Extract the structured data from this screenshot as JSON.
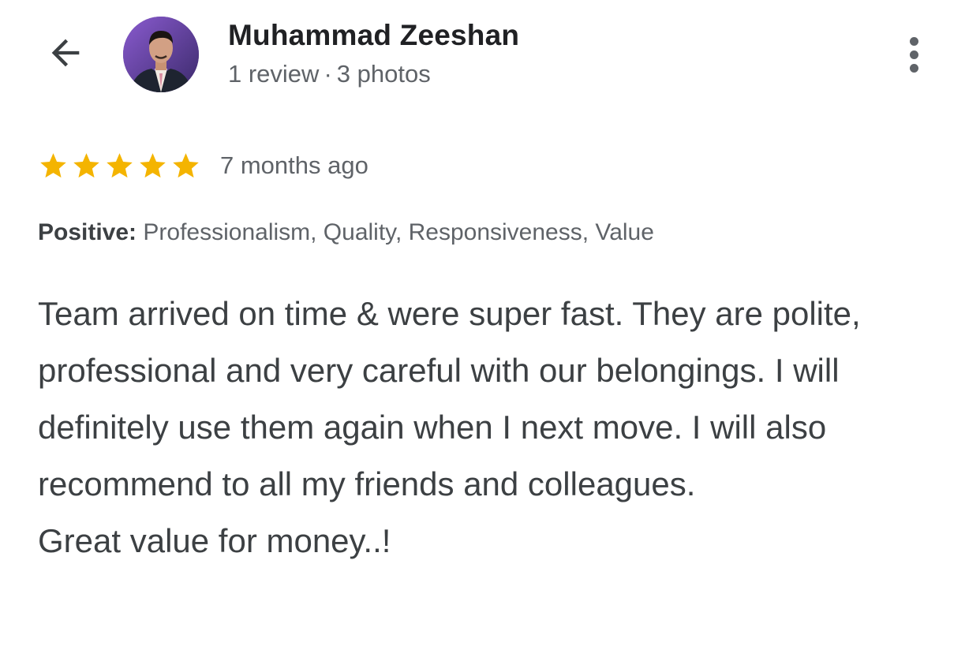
{
  "header": {
    "back_icon": "arrow-back-icon",
    "avatar": "reviewer-avatar",
    "name": "Muhammad Zeeshan",
    "review_count": "1 review",
    "meta_separator": "·",
    "photo_count": "3 photos",
    "more_icon": "more-vert-icon"
  },
  "rating": {
    "stars": 5,
    "max_stars": 5,
    "star_color": "#F4B400",
    "date": "7 months ago"
  },
  "positive": {
    "label": "Positive:",
    "values": "Professionalism, Quality, Responsiveness, Value"
  },
  "review": {
    "text": "Team arrived on time & were super fast. They are polite, professional and very careful with our belongings. I will definitely use them again when I next move. I will also recommend to all my friends and colleagues.\nGreat value for money..!"
  },
  "colors": {
    "text_primary": "#202124",
    "text_secondary": "#5f6368",
    "text_body": "#3c4043",
    "background": "#ffffff"
  }
}
